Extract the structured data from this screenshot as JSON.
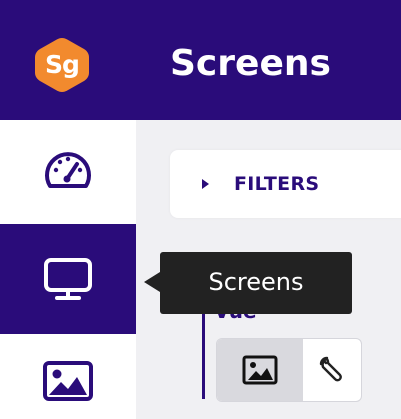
{
  "header": {
    "logo_text": "Sg",
    "title": "Screens"
  },
  "sidebar": {
    "items": [
      {
        "icon": "dashboard-gauge-icon",
        "active": false
      },
      {
        "icon": "monitor-icon",
        "active": true
      },
      {
        "icon": "image-icon",
        "active": false
      }
    ]
  },
  "main": {
    "filters_label": "FILTERS",
    "section_label": "Vue",
    "view_toggle": {
      "options": [
        {
          "icon": "image-icon",
          "selected": true
        },
        {
          "icon": "wrench-icon",
          "selected": false
        }
      ]
    }
  },
  "tooltip": {
    "text": "Screens"
  },
  "colors": {
    "brand": "#2a0c7a",
    "logo_orange": "#f28a2e",
    "tooltip_bg": "#222222",
    "panel_bg": "#f0f0f3"
  }
}
